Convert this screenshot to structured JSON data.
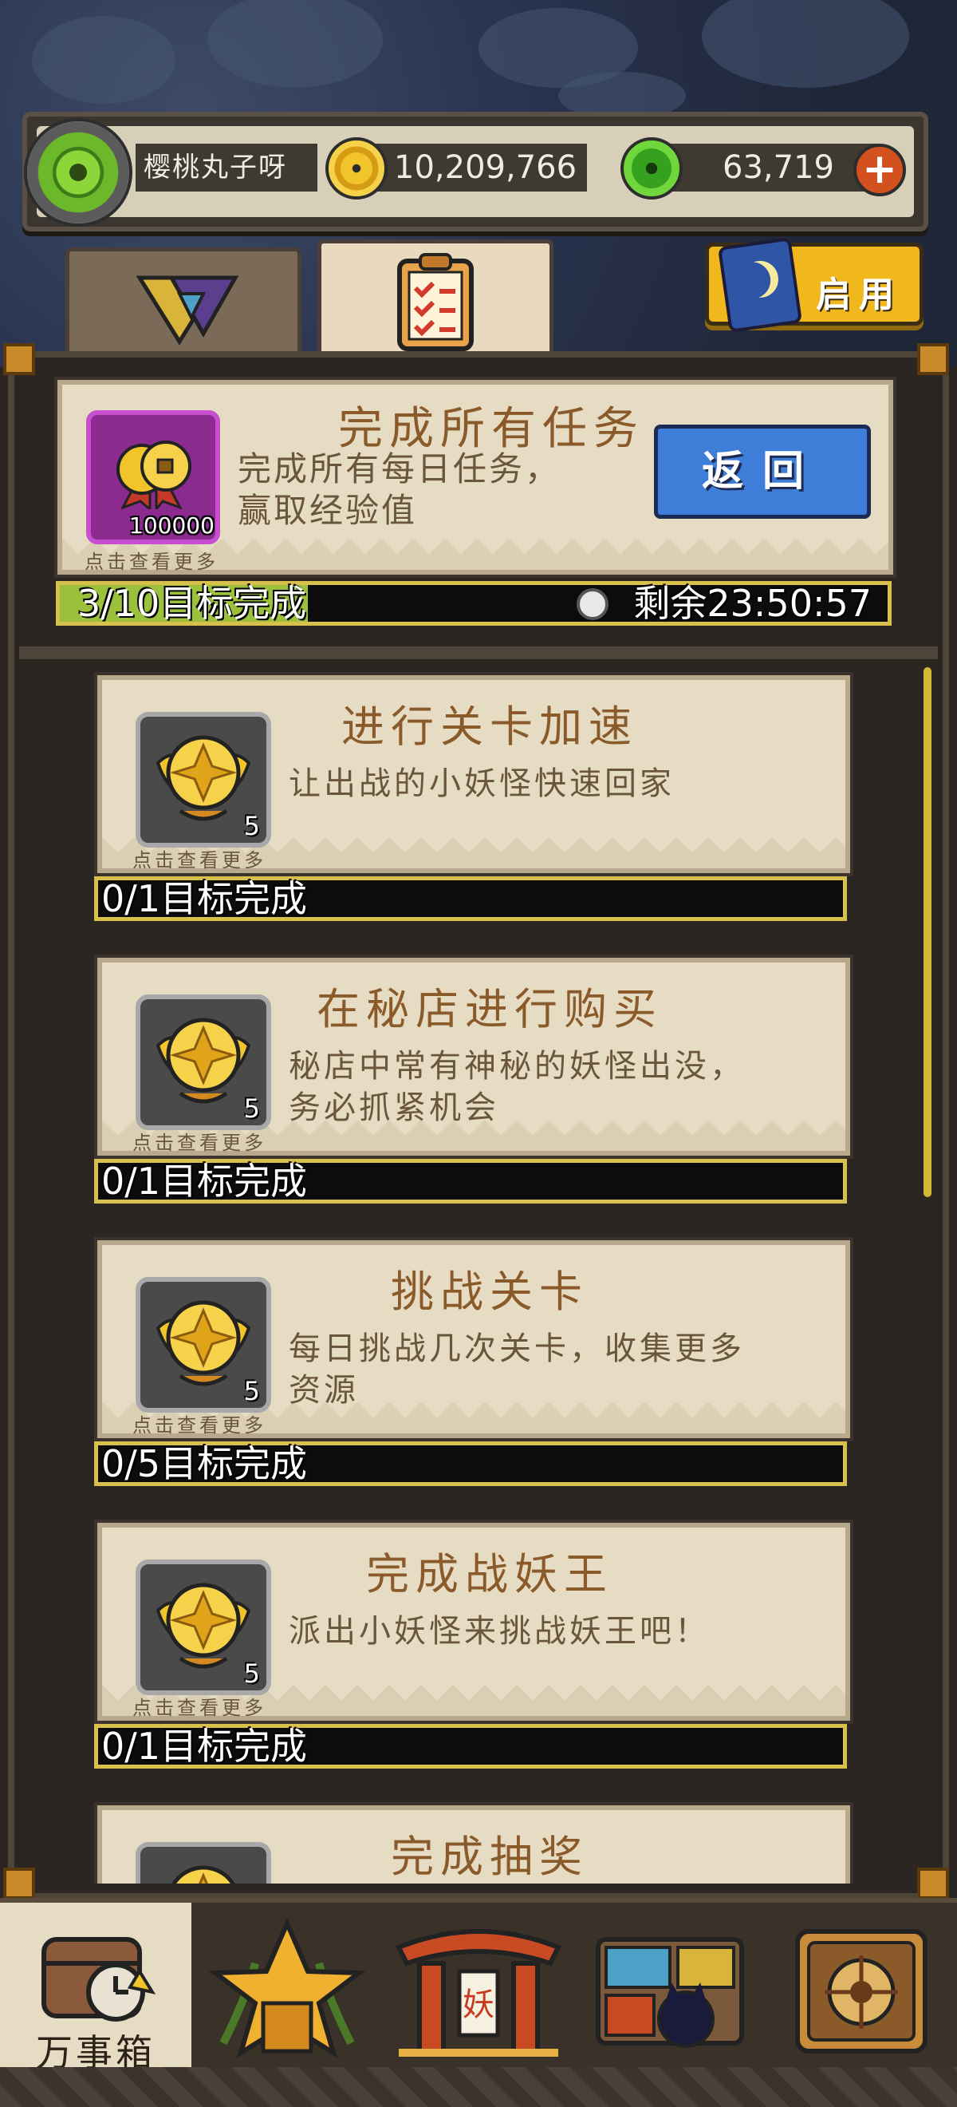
{
  "header": {
    "player_name": "樱桃丸子呀",
    "gold": "10,209,766",
    "gems": "63,719",
    "plus_icon": "plus-icon"
  },
  "tabs": {
    "first_icon": "flags-icon",
    "second_icon": "task-list-icon"
  },
  "activate_button": {
    "label": "启用"
  },
  "summary": {
    "title": "完成所有任务",
    "desc_line1": "完成所有每日任务，",
    "desc_line2": "赢取经验值",
    "reward_count": "100000",
    "click_more": "点击查看更多",
    "back_label": "返回",
    "progress_text": "3/10目标完成",
    "progress_fraction": 0.3,
    "timer_text": "剩余23:50:57"
  },
  "tasks": [
    {
      "title": "进行关卡加速",
      "desc_line1": "让出战的小妖怪快速回家",
      "desc_line2": "",
      "reward_count": "5",
      "click_more": "点击查看更多",
      "progress_text": "0/1目标完成"
    },
    {
      "title": "在秘店进行购买",
      "desc_line1": "秘店中常有神秘的妖怪出没，",
      "desc_line2": "务必抓紧机会",
      "reward_count": "5",
      "click_more": "点击查看更多",
      "progress_text": "0/1目标完成"
    },
    {
      "title": "挑战关卡",
      "desc_line1": "每日挑战几次关卡，收集更多",
      "desc_line2": "资源",
      "reward_count": "5",
      "click_more": "点击查看更多",
      "progress_text": "0/5目标完成"
    },
    {
      "title": "完成战妖王",
      "desc_line1": "派出小妖怪来挑战妖王吧！",
      "desc_line2": "",
      "reward_count": "5",
      "click_more": "点击查看更多",
      "progress_text": "0/1目标完成"
    },
    {
      "title": "完成抽奖",
      "desc_line1": "",
      "desc_line2": "",
      "reward_count": "",
      "click_more": "",
      "progress_text": ""
    }
  ],
  "bottom_nav": {
    "items": [
      {
        "label": "万事箱",
        "icon": "treasure-chest-clock-icon"
      },
      {
        "label": "",
        "icon": "star-trophy-icon"
      },
      {
        "label": "",
        "icon": "demon-gate-icon"
      },
      {
        "label": "",
        "icon": "shop-cat-icon"
      },
      {
        "label": "",
        "icon": "book-icon"
      }
    ]
  },
  "colors": {
    "title_brown": "#8a5a2a",
    "progress_border": "#d7c04c",
    "back_blue": "#3f7ed8",
    "activate_yellow": "#f0b81c"
  }
}
